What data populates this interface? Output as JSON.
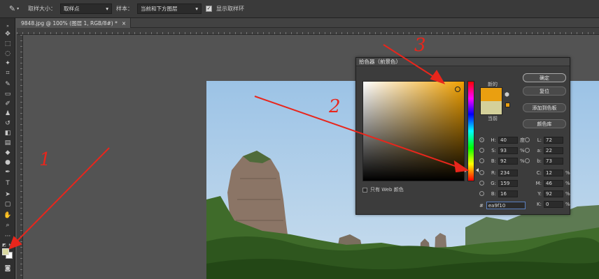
{
  "options_bar": {
    "sample_size_label": "取样大小：",
    "sample_size_value": "取样点",
    "sample_label": "样本：",
    "sample_value": "当前和下方图层",
    "show_ring_label": "显示取样环"
  },
  "document": {
    "tab_title": "9848.jpg @ 100% (图层 1, RGB/8#) *",
    "close": "×"
  },
  "color_picker": {
    "title": "拾色器（前景色）",
    "new_label": "新的",
    "current_label": "当前",
    "buttons": {
      "ok": "确定",
      "reset": "复位",
      "add_swatch": "添加到色板",
      "color_libraries": "颜色库"
    },
    "hsb": [
      {
        "label": "H:",
        "value": "40",
        "unit": "度",
        "selected": true
      },
      {
        "label": "S:",
        "value": "93",
        "unit": "%",
        "selected": false
      },
      {
        "label": "B:",
        "value": "92",
        "unit": "%",
        "selected": false
      }
    ],
    "rgb": [
      {
        "label": "R:",
        "value": "234"
      },
      {
        "label": "G:",
        "value": "159"
      },
      {
        "label": "B:",
        "value": "16"
      }
    ],
    "lab": [
      {
        "label": "L:",
        "value": "72"
      },
      {
        "label": "a:",
        "value": "22"
      },
      {
        "label": "b:",
        "value": "73"
      }
    ],
    "cmyk": [
      {
        "label": "C:",
        "value": "12",
        "unit": "%"
      },
      {
        "label": "M:",
        "value": "46",
        "unit": "%"
      },
      {
        "label": "Y:",
        "value": "92",
        "unit": "%"
      },
      {
        "label": "K:",
        "value": "0",
        "unit": "%"
      }
    ],
    "hex_label": "#",
    "hex_value": "ea9f10",
    "web_only_label": "只有 Web 颜色",
    "new_color": "#ea9f10",
    "current_color": "#d4d09a"
  },
  "annotations": {
    "num1": "1",
    "num2": "2",
    "num3": "3",
    "color": "#e8261c"
  },
  "colors": {
    "foreground": "#d8d8a0",
    "background": "#ffffff"
  }
}
